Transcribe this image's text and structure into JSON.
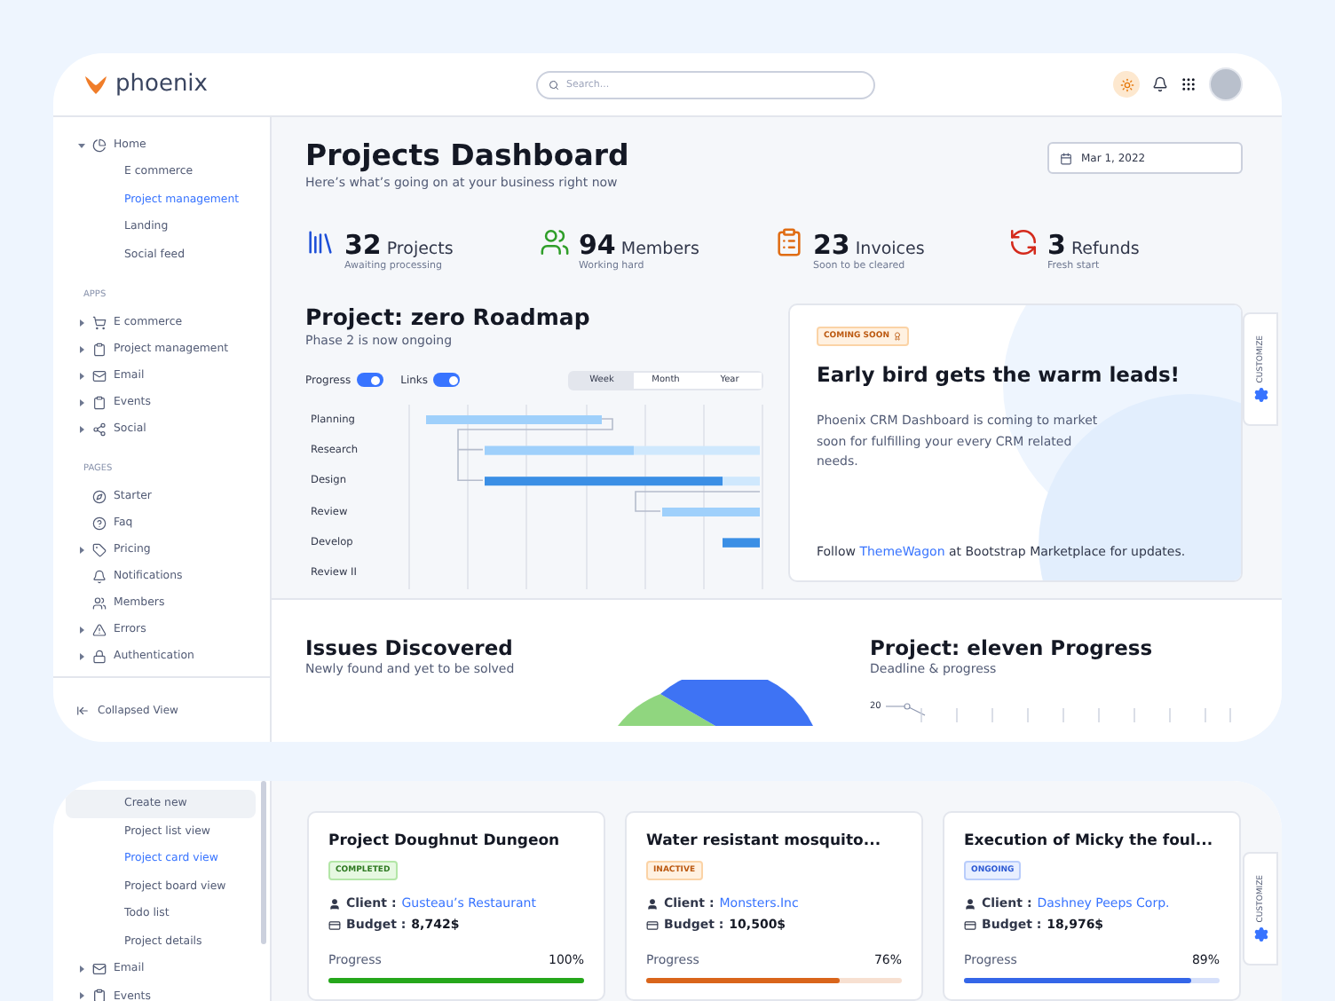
{
  "topbar": {
    "logo": "phoenix",
    "search": {
      "placeholder": "Search..."
    }
  },
  "sidebar": {
    "sections": [
      {
        "items": [
          {
            "label": "Home",
            "expanded": true,
            "children": [
              {
                "label": "E commerce",
                "selected": false
              },
              {
                "label": "Project management",
                "selected": true
              },
              {
                "label": "Landing",
                "selected": false
              },
              {
                "label": "Social feed",
                "selected": false
              }
            ]
          }
        ]
      },
      {
        "label": "APPS",
        "items": [
          {
            "label": "E commerce",
            "expanded": false
          },
          {
            "label": "Project management",
            "expanded": false
          },
          {
            "label": "Email",
            "expanded": false
          },
          {
            "label": "Events",
            "expanded": false
          },
          {
            "label": "Social",
            "expanded": false
          }
        ]
      },
      {
        "label": "PAGES",
        "items": [
          {
            "label": "Starter"
          },
          {
            "label": "Faq"
          },
          {
            "label": "Pricing",
            "expanded": false
          },
          {
            "label": "Notifications"
          },
          {
            "label": "Members"
          },
          {
            "label": "Errors",
            "expanded": false
          },
          {
            "label": "Authentication",
            "expanded": false
          }
        ]
      }
    ],
    "footer": "Collapsed View"
  },
  "header": {
    "title": "Projects Dashboard",
    "subtitle": "Here’s what’s going on at your business right now",
    "date": "Mar 1, 2022"
  },
  "stats": [
    {
      "value": "32",
      "label": "Projects",
      "note": "Awaiting processing",
      "color": "#1d4fd8"
    },
    {
      "value": "94",
      "label": "Members",
      "note": "Working hard",
      "color": "#2f9e29"
    },
    {
      "value": "23",
      "label": "Invoices",
      "note": "Soon to be cleared",
      "color": "#e06c13"
    },
    {
      "value": "3",
      "label": "Refunds",
      "note": "Fresh start",
      "color": "#d42a1c"
    }
  ],
  "roadmap": {
    "title": "Project: zero Roadmap",
    "subtitle": "Phase 2 is now ongoing",
    "toggles": [
      {
        "label": "Progress",
        "on": true
      },
      {
        "label": "Links",
        "on": true
      }
    ],
    "views": [
      {
        "label": "Week",
        "selected": true
      },
      {
        "label": "Month",
        "selected": false
      },
      {
        "label": "Year",
        "selected": false
      }
    ],
    "tasks": [
      "Planning",
      "Research",
      "Design",
      "Review",
      "Develop",
      "Review II"
    ]
  },
  "promo": {
    "badge": "COMING SOON",
    "title": "Early bird gets the warm leads!",
    "body": "Phoenix CRM Dashboard is coming to market soon for fulfilling your every CRM related needs.",
    "footer_before": "Follow ",
    "footer_link": "ThemeWagon",
    "footer_after": " at Bootstrap Marketplace for updates."
  },
  "customize": [
    "CUSTOMIZE",
    "CUSTOMIZE"
  ],
  "issues": {
    "title": "Issues Discovered",
    "subtitle": "Newly found and yet to be solved"
  },
  "progress_chart": {
    "title": "Project: eleven Progress",
    "subtitle": "Deadline & progress",
    "y_tick": "20"
  },
  "sidebar2": {
    "items": [
      {
        "kind": "link",
        "label": "Create new",
        "highlighted": true,
        "selected": false
      },
      {
        "kind": "link",
        "label": "Project list view",
        "highlighted": false,
        "selected": false
      },
      {
        "kind": "link",
        "label": "Project card view",
        "highlighted": false,
        "selected": true
      },
      {
        "kind": "link",
        "label": "Project board view",
        "highlighted": false,
        "selected": false
      },
      {
        "kind": "link",
        "label": "Todo list",
        "highlighted": false,
        "selected": false
      },
      {
        "kind": "link",
        "label": "Project details",
        "highlighted": false,
        "selected": false
      },
      {
        "kind": "group",
        "label": "Email",
        "highlighted": false,
        "selected": false
      },
      {
        "kind": "group",
        "label": "Events",
        "highlighted": false,
        "selected": false
      }
    ]
  },
  "cards": [
    {
      "title": "Project Doughnut Dungeon",
      "status": "COMPLETED",
      "kind": "success",
      "client_label": "Client :",
      "client": "Gusteau’s Restaurant",
      "budget_label": "Budget :",
      "budget": "8,742$",
      "progress_label": "Progress",
      "percent": "100%",
      "level": 1,
      "color": "#25a71b"
    },
    {
      "title": "Water resistant mosquito...",
      "status": "INACTIVE",
      "kind": "warning",
      "client_label": "Client :",
      "client": "Monsters.Inc",
      "budget_label": "Budget :",
      "budget": "10,500$",
      "progress_label": "Progress",
      "percent": "76%",
      "level": 0.76,
      "color": "#d9651b"
    },
    {
      "title": "Execution of Micky the foul...",
      "status": "ONGOING",
      "kind": "info",
      "client_label": "Client :",
      "client": "Dashney Peeps Corp.",
      "budget_label": "Budget :",
      "budget": "18,976$",
      "progress_label": "Progress",
      "percent": "89%",
      "level": 0.89,
      "color": "#3466e8"
    }
  ]
}
